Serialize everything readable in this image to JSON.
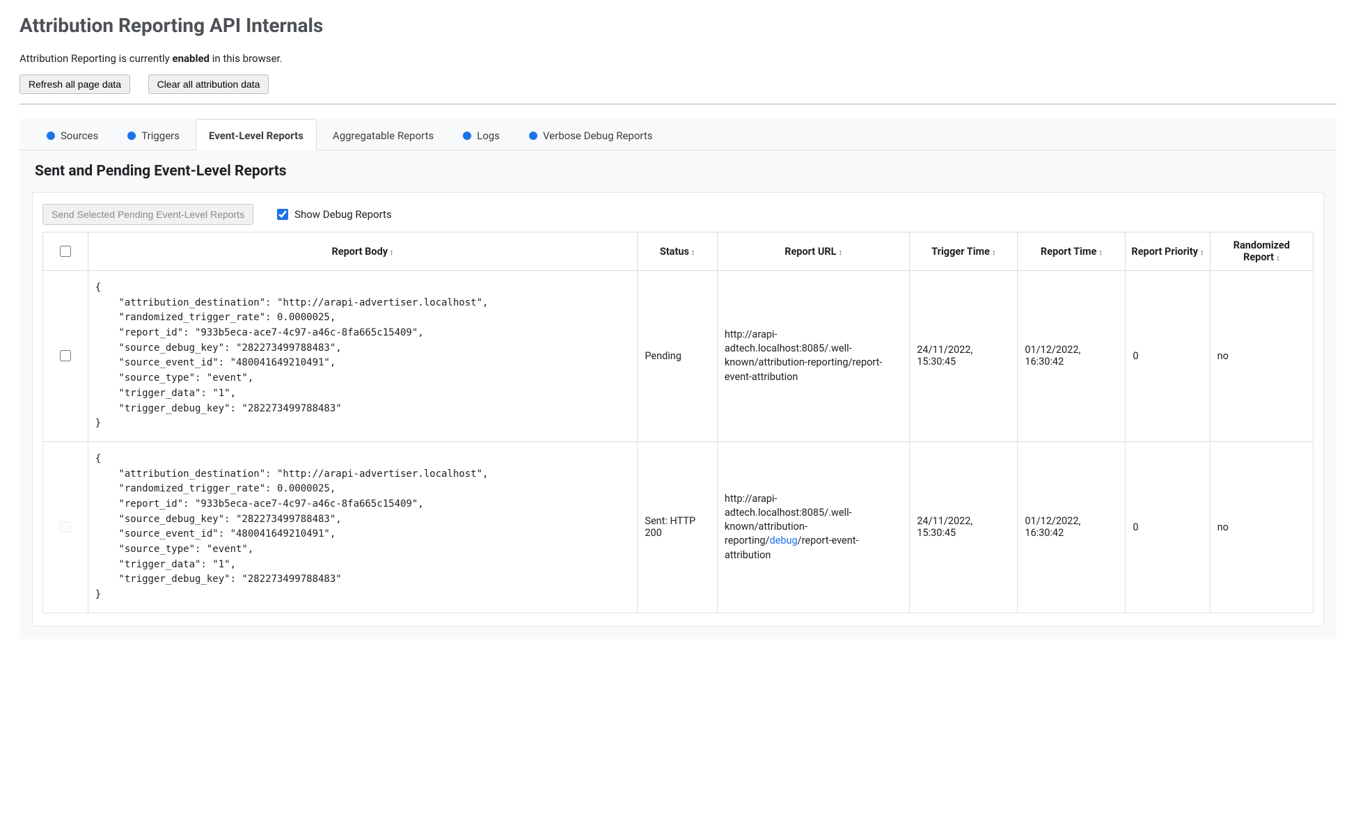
{
  "header": {
    "title": "Attribution Reporting API Internals",
    "status_prefix": "Attribution Reporting is currently ",
    "status_bold": "enabled",
    "status_suffix": " in this browser.",
    "refresh_btn": "Refresh all page data",
    "clear_btn": "Clear all attribution data"
  },
  "tabs": {
    "sources": "Sources",
    "triggers": "Triggers",
    "event_reports": "Event-Level Reports",
    "agg_reports": "Aggregatable Reports",
    "logs": "Logs",
    "verbose": "Verbose Debug Reports"
  },
  "section": {
    "title": "Sent and Pending Event-Level Reports",
    "send_btn": "Send Selected Pending Event-Level Reports",
    "show_debug_label": "Show Debug Reports"
  },
  "table": {
    "headers": {
      "body": "Report Body",
      "status": "Status",
      "url": "Report URL",
      "trigger_time": "Trigger Time",
      "report_time": "Report Time",
      "priority": "Report Priority",
      "randomized": "Randomized Report"
    },
    "rows": [
      {
        "checkbox_disabled": false,
        "body": "{\n    \"attribution_destination\": \"http://arapi-advertiser.localhost\",\n    \"randomized_trigger_rate\": 0.0000025,\n    \"report_id\": \"933b5eca-ace7-4c97-a46c-8fa665c15409\",\n    \"source_debug_key\": \"282273499788483\",\n    \"source_event_id\": \"480041649210491\",\n    \"source_type\": \"event\",\n    \"trigger_data\": \"1\",\n    \"trigger_debug_key\": \"282273499788483\"\n}",
        "status": "Pending",
        "url_prefix": "http://arapi-adtech.localhost:8085/.well-known/attribution-reporting/",
        "url_debug": "",
        "url_suffix": "report-event-attribution",
        "trigger_time": "24/11/2022, 15:30:45",
        "report_time": "01/12/2022, 16:30:42",
        "priority": "0",
        "randomized": "no"
      },
      {
        "checkbox_disabled": true,
        "body": "{\n    \"attribution_destination\": \"http://arapi-advertiser.localhost\",\n    \"randomized_trigger_rate\": 0.0000025,\n    \"report_id\": \"933b5eca-ace7-4c97-a46c-8fa665c15409\",\n    \"source_debug_key\": \"282273499788483\",\n    \"source_event_id\": \"480041649210491\",\n    \"source_type\": \"event\",\n    \"trigger_data\": \"1\",\n    \"trigger_debug_key\": \"282273499788483\"\n}",
        "status": "Sent: HTTP 200",
        "url_prefix": "http://arapi-adtech.localhost:8085/.well-known/attribution-reporting/",
        "url_debug": "debug",
        "url_suffix": "/report-event-attribution",
        "trigger_time": "24/11/2022, 15:30:45",
        "report_time": "01/12/2022, 16:30:42",
        "priority": "0",
        "randomized": "no"
      }
    ]
  }
}
